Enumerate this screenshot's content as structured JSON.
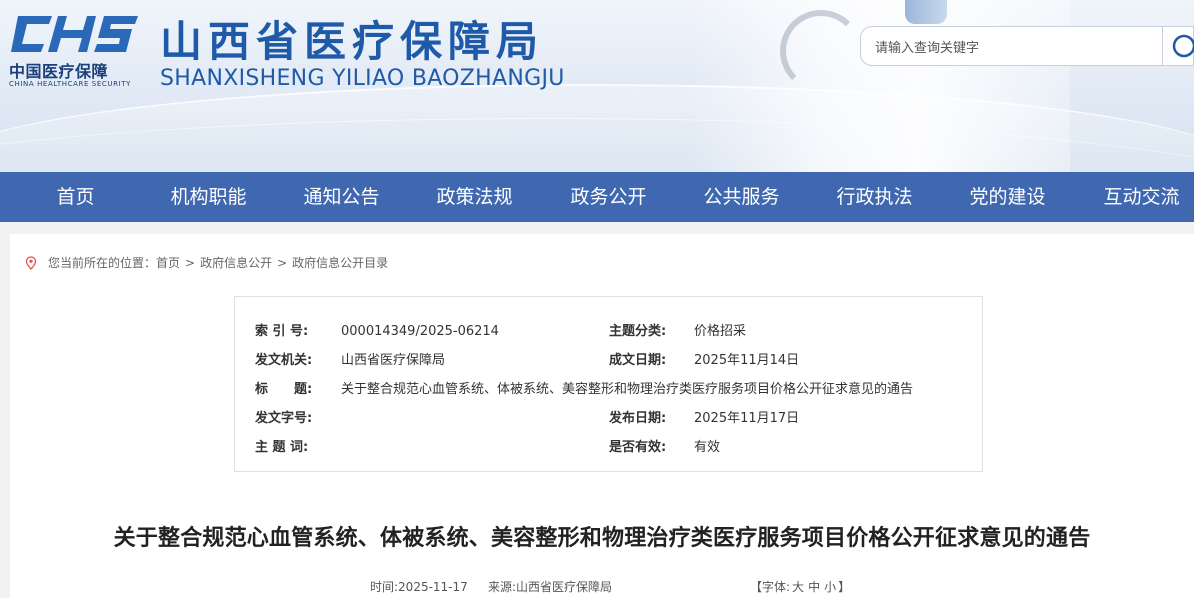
{
  "header": {
    "logo_cn": "中国医疗保障",
    "logo_en": "CHINA HEALTHCARE SECURITY",
    "logo_mark_text": "CHS",
    "title": "山西省医疗保障局",
    "subtitle": "SHANXISHENG YILIAO BAOZHANGJU",
    "search_placeholder": "请输入查询关键字",
    "brand_color": "#1f5aa8"
  },
  "nav": {
    "color": "#3f68b0",
    "items": [
      "首页",
      "机构职能",
      "通知公告",
      "政策法规",
      "政务公开",
      "公共服务",
      "行政执法",
      "党的建设",
      "互动交流"
    ]
  },
  "breadcrumb": {
    "prefix": "您当前所在的位置：",
    "items": [
      "首页",
      "政府信息公开",
      "政府信息公开目录"
    ],
    "separator": ">"
  },
  "meta": {
    "index_label": "索 引 号:",
    "index_value": "000014349/2025-06214",
    "category_label": "主题分类:",
    "category_value": "价格招采",
    "issuer_label": "发文机关:",
    "issuer_value": "山西省医疗保障局",
    "created_label": "成文日期:",
    "created_value": "2025年11月14日",
    "title_label": "标　　题:",
    "title_value": "关于整合规范心血管系统、体被系统、美容整形和物理治疗类医疗服务项目价格公开征求意见的通告",
    "docno_label": "发文字号:",
    "docno_value": "",
    "published_label": "发布日期:",
    "published_value": "2025年11月17日",
    "keywords_label": "主 题 词:",
    "keywords_value": "",
    "valid_label": "是否有效:",
    "valid_value": "有效"
  },
  "article": {
    "title": "关于整合规范心血管系统、体被系统、美容整形和物理治疗类医疗服务项目价格公开征求意见的通告",
    "time": "时间:2025-11-17",
    "source": "来源:山西省医疗保障局",
    "font_prefix": "【字体:",
    "font_large": "大",
    "font_medium": "中",
    "font_small": "小",
    "font_suffix": "】"
  }
}
